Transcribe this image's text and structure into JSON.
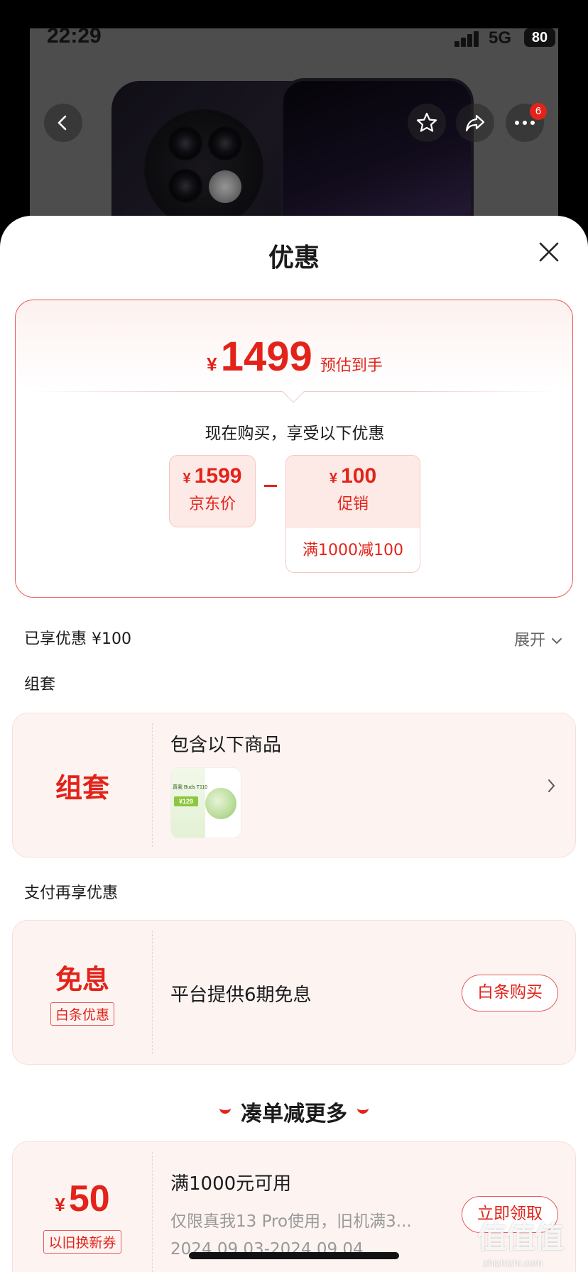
{
  "status_bar": {
    "time": "22:29",
    "network": "5G",
    "battery": "80"
  },
  "top_bar": {
    "notification_count": "6"
  },
  "sheet": {
    "title": "优惠",
    "estimate": {
      "currency": "¥",
      "price": "1499",
      "label": "预估到手",
      "buy_now_text": "现在购买，享受以下优惠",
      "jd_price": {
        "currency": "¥",
        "value": "1599",
        "label": "京东价"
      },
      "promotion": {
        "currency": "¥",
        "value": "100",
        "label": "促销",
        "rule": "满1000减100"
      }
    },
    "enjoyed": {
      "label": "已享优惠 ¥100",
      "expand_label": "展开"
    },
    "bundle_section": {
      "heading": "组套",
      "card_title": "组套",
      "contains_text": "包含以下商品",
      "product_thumb_text": "真我 Buds T110",
      "product_price_text": "¥129"
    },
    "payment_section": {
      "heading": "支付再享优惠",
      "card_title": "免息",
      "tag": "白条优惠",
      "description": "平台提供6期免息",
      "button": "白条购买"
    },
    "more_section": {
      "heading": "凑单减更多"
    },
    "coupon": {
      "currency": "¥",
      "value": "50",
      "tag": "以旧换新券",
      "title": "满1000元可用",
      "description": "仅限真我13 Pro使用，旧机满3...",
      "validity": "2024.09.03-2024.09.04",
      "button": "立即领取"
    }
  },
  "watermark": {
    "main": "值值值",
    "sub": "zhizhizhi.com"
  },
  "colors": {
    "accent": "#e2231a",
    "card_bg": "#fdf4f2",
    "border": "#e8595a"
  }
}
